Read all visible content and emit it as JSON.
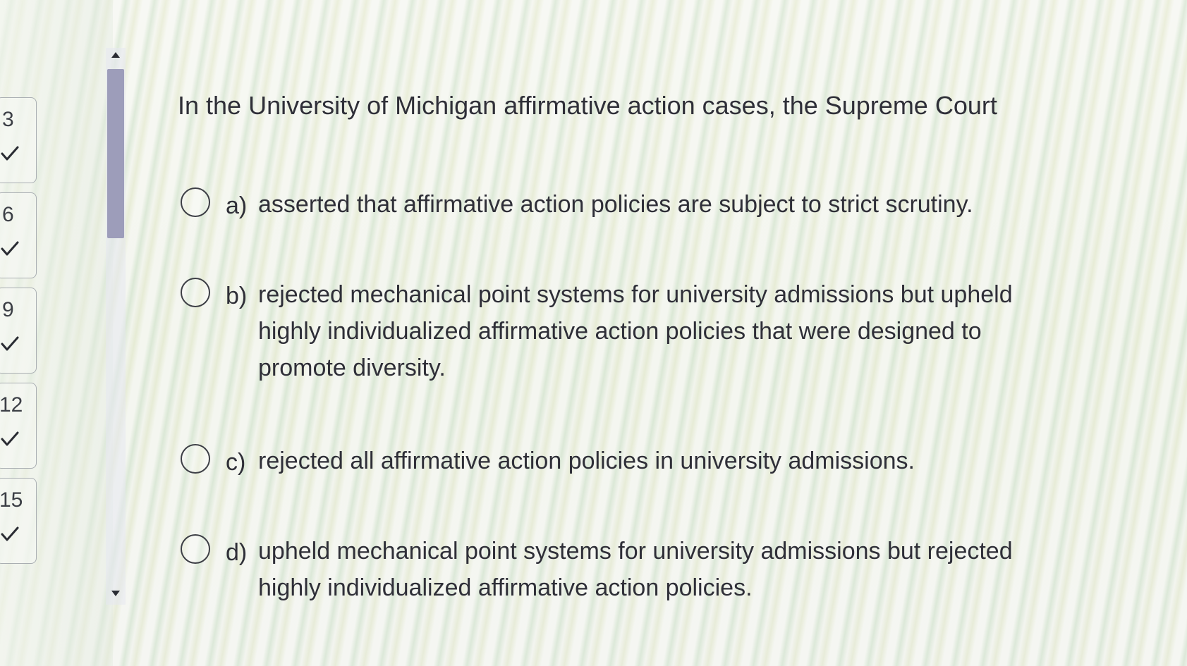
{
  "question": {
    "text": "In the University of Michigan affirmative action cases, the Supreme Court"
  },
  "options": [
    {
      "letter": "a)",
      "text": "asserted that affirmative action policies are subject to strict scrutiny."
    },
    {
      "letter": "b)",
      "text": "rejected mechanical point systems for university admissions but upheld highly individualized affirmative action policies that were designed to promote diversity."
    },
    {
      "letter": "c)",
      "text": "rejected all affirmative action policies in university admissions."
    },
    {
      "letter": "d)",
      "text": "upheld mechanical point systems for university admissions but rejected highly individualized affirmative action policies."
    }
  ],
  "nav": {
    "items": [
      {
        "number": "3",
        "status_icon": "check-icon"
      },
      {
        "number": "6",
        "status_icon": "check-icon"
      },
      {
        "number": "9",
        "status_icon": "check-icon"
      },
      {
        "number": "12",
        "status_icon": "check-icon"
      },
      {
        "number": "15",
        "status_icon": "check-icon"
      }
    ]
  },
  "colors": {
    "text": "#2f2f38",
    "scroll_thumb": "#9d9dba",
    "card_border": "#a9aeb2"
  }
}
